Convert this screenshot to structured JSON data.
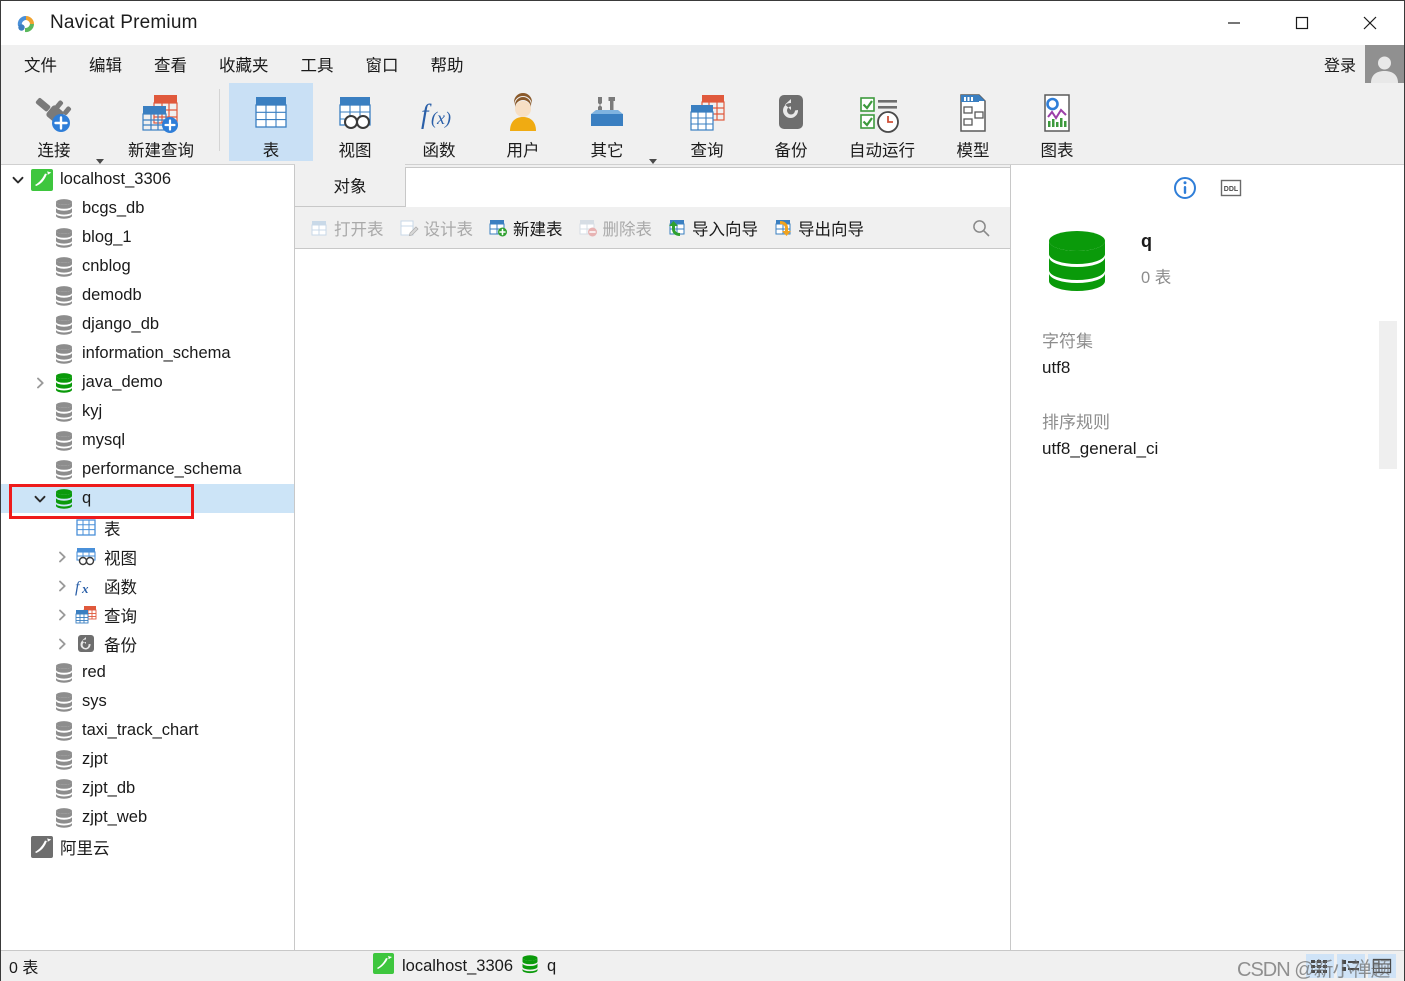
{
  "window": {
    "title": "Navicat Premium",
    "logo_icon": "navicat-logo-icon",
    "minimize_label": "—",
    "maximize_label": "□",
    "close_label": "✕"
  },
  "menubar": {
    "items": [
      {
        "label": "文件"
      },
      {
        "label": "编辑"
      },
      {
        "label": "查看"
      },
      {
        "label": "收藏夹"
      },
      {
        "label": "工具"
      },
      {
        "label": "窗口"
      },
      {
        "label": "帮助"
      }
    ],
    "login_label": "登录",
    "avatar_icon": "user-avatar-icon"
  },
  "toolbar": {
    "buttons": [
      {
        "label": "连接",
        "icon": "connection-plug-icon",
        "active": false,
        "caret": true
      },
      {
        "label": "新建查询",
        "icon": "new-query-icon",
        "active": false,
        "caret": false
      },
      {
        "label": "表",
        "icon": "table-icon",
        "active": true,
        "caret": false
      },
      {
        "label": "视图",
        "icon": "view-icon",
        "active": false,
        "caret": false
      },
      {
        "label": "函数",
        "icon": "function-fx-icon",
        "active": false,
        "caret": false
      },
      {
        "label": "用户",
        "icon": "user-icon",
        "active": false,
        "caret": false
      },
      {
        "label": "其它",
        "icon": "other-tools-icon",
        "active": false,
        "caret": true
      },
      {
        "label": "查询",
        "icon": "query-icon",
        "active": false,
        "caret": false
      },
      {
        "label": "备份",
        "icon": "backup-icon",
        "active": false,
        "caret": false
      },
      {
        "label": "自动运行",
        "icon": "automation-icon",
        "active": false,
        "caret": false
      },
      {
        "label": "模型",
        "icon": "model-icon",
        "active": false,
        "caret": false
      },
      {
        "label": "图表",
        "icon": "chart-icon",
        "active": false,
        "caret": false
      }
    ]
  },
  "sidebar": {
    "rows": [
      {
        "label": "localhost_3306",
        "icon": "mysql-connection-icon",
        "indent": 0,
        "twisty": "down",
        "selected": false
      },
      {
        "label": "bcgs_db",
        "icon": "database-gray-icon",
        "indent": 1,
        "twisty": "none",
        "selected": false
      },
      {
        "label": "blog_1",
        "icon": "database-gray-icon",
        "indent": 1,
        "twisty": "none",
        "selected": false
      },
      {
        "label": "cnblog",
        "icon": "database-gray-icon",
        "indent": 1,
        "twisty": "none",
        "selected": false
      },
      {
        "label": "demodb",
        "icon": "database-gray-icon",
        "indent": 1,
        "twisty": "none",
        "selected": false
      },
      {
        "label": "django_db",
        "icon": "database-gray-icon",
        "indent": 1,
        "twisty": "none",
        "selected": false
      },
      {
        "label": "information_schema",
        "icon": "database-gray-icon",
        "indent": 1,
        "twisty": "none",
        "selected": false
      },
      {
        "label": "java_demo",
        "icon": "database-green-icon",
        "indent": 1,
        "twisty": "right",
        "selected": false
      },
      {
        "label": "kyj",
        "icon": "database-gray-icon",
        "indent": 1,
        "twisty": "none",
        "selected": false
      },
      {
        "label": "mysql",
        "icon": "database-gray-icon",
        "indent": 1,
        "twisty": "none",
        "selected": false
      },
      {
        "label": "performance_schema",
        "icon": "database-gray-icon",
        "indent": 1,
        "twisty": "none",
        "selected": false
      },
      {
        "label": "q",
        "icon": "database-green-icon",
        "indent": 1,
        "twisty": "down",
        "selected": true
      },
      {
        "label": "表",
        "icon": "table-folder-icon",
        "indent": 2,
        "twisty": "none",
        "selected": false
      },
      {
        "label": "视图",
        "icon": "view-folder-icon",
        "indent": 2,
        "twisty": "right",
        "selected": false
      },
      {
        "label": "函数",
        "icon": "function-folder-icon",
        "indent": 2,
        "twisty": "right",
        "selected": false
      },
      {
        "label": "查询",
        "icon": "query-folder-icon",
        "indent": 2,
        "twisty": "right",
        "selected": false
      },
      {
        "label": "备份",
        "icon": "backup-folder-icon",
        "indent": 2,
        "twisty": "right",
        "selected": false
      },
      {
        "label": "red",
        "icon": "database-gray-icon",
        "indent": 1,
        "twisty": "none",
        "selected": false
      },
      {
        "label": "sys",
        "icon": "database-gray-icon",
        "indent": 1,
        "twisty": "none",
        "selected": false
      },
      {
        "label": "taxi_track_chart",
        "icon": "database-gray-icon",
        "indent": 1,
        "twisty": "none",
        "selected": false
      },
      {
        "label": "zjpt",
        "icon": "database-gray-icon",
        "indent": 1,
        "twisty": "none",
        "selected": false
      },
      {
        "label": "zjpt_db",
        "icon": "database-gray-icon",
        "indent": 1,
        "twisty": "none",
        "selected": false
      },
      {
        "label": "zjpt_web",
        "icon": "database-gray-icon",
        "indent": 1,
        "twisty": "none",
        "selected": false
      },
      {
        "label": "阿里云",
        "icon": "mysql-connection-gray-icon",
        "indent": 0,
        "twisty": "none",
        "selected": false
      }
    ]
  },
  "center": {
    "tab_label": "对象",
    "object_toolbar": [
      {
        "label": "打开表",
        "icon": "open-table-icon",
        "disabled": true
      },
      {
        "label": "设计表",
        "icon": "design-table-icon",
        "disabled": true
      },
      {
        "label": "新建表",
        "icon": "new-table-icon",
        "disabled": false
      },
      {
        "label": "删除表",
        "icon": "delete-table-icon",
        "disabled": true
      },
      {
        "label": "导入向导",
        "icon": "import-wizard-icon",
        "disabled": false
      },
      {
        "label": "导出向导",
        "icon": "export-wizard-icon",
        "disabled": false
      }
    ],
    "search_icon": "search-icon"
  },
  "info_panel": {
    "info_tab_icon": "info-circle-icon",
    "ddl_tab_label": "DDL",
    "db_icon": "database-green-large-icon",
    "db_name": "q",
    "db_count": "0 表",
    "fields": [
      {
        "label": "字符集",
        "value": "utf8"
      },
      {
        "label": "排序规则",
        "value": "utf8_general_ci"
      }
    ]
  },
  "statusbar": {
    "left_text": "0 表",
    "connection_icon": "mysql-connection-icon",
    "connection_name": "localhost_3306",
    "database_icon": "database-green-icon",
    "database_name": "q",
    "view_buttons": [
      {
        "icon": "grid-view-icon"
      },
      {
        "icon": "list-view-icon"
      },
      {
        "icon": "detail-view-icon"
      }
    ],
    "watermark_text": "CSDN @新小禅题"
  },
  "colors": {
    "accent_blue": "#2f7ed8",
    "selection_blue": "#cce4f7",
    "highlight_red": "#ee1b1b",
    "db_green": "#13a013",
    "toolbar_bg": "#f0f0f0"
  }
}
